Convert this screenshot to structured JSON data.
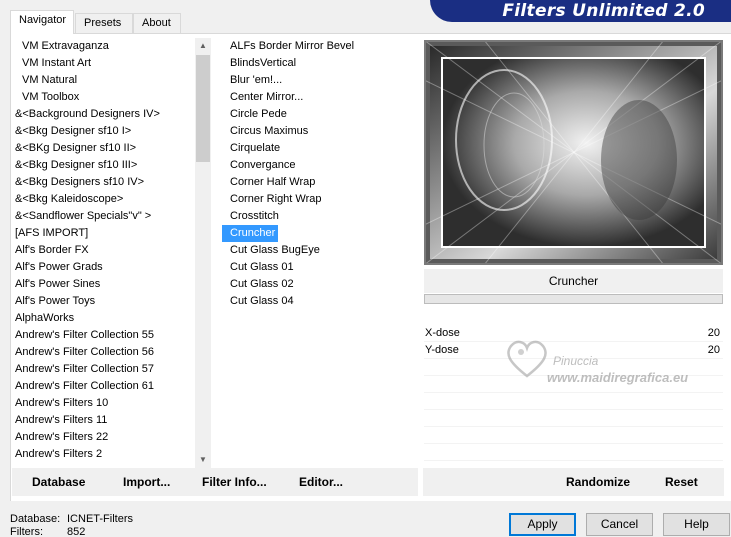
{
  "header": {
    "title": "Filters Unlimited 2.0"
  },
  "tabs": [
    {
      "label": "Navigator",
      "active": true
    },
    {
      "label": "Presets",
      "active": false
    },
    {
      "label": "About",
      "active": false
    }
  ],
  "categories": [
    "VM Extravaganza",
    "VM Instant Art",
    "VM Natural",
    "VM Toolbox",
    "&<Background Designers IV>",
    "&<Bkg Designer sf10 I>",
    "&<BKg Designer sf10 II>",
    "&<Bkg Designer sf10 III>",
    "&<Bkg Designers sf10 IV>",
    "&<Bkg Kaleidoscope>",
    "&<Sandflower Specials\"v\" >",
    "[AFS IMPORT]",
    "Alf's Border FX",
    "Alf's Power Grads",
    "Alf's Power Sines",
    "Alf's Power Toys",
    "AlphaWorks",
    "Andrew's Filter Collection 55",
    "Andrew's Filter Collection 56",
    "Andrew's Filter Collection 57",
    "Andrew's Filter Collection 61",
    "Andrew's Filters 10",
    "Andrew's Filters 11",
    "Andrew's Filters 22",
    "Andrew's Filters 2"
  ],
  "filters": [
    "ALFs Border Mirror Bevel",
    "BlindsVertical",
    "Blur 'em!...",
    "Center Mirror...",
    "Circle Pede",
    "Circus Maximus",
    "Cirquelate",
    "Convergance",
    "Corner Half Wrap",
    "Corner Right Wrap",
    "Crosstitch",
    "Cruncher",
    "Cut Glass  BugEye",
    "Cut Glass 01",
    "Cut Glass 02",
    "Cut Glass 04"
  ],
  "selected_filter": "Cruncher",
  "params": [
    {
      "label": "X-dose",
      "value": "20"
    },
    {
      "label": "Y-dose",
      "value": "20"
    }
  ],
  "watermark": {
    "name": "Pinuccia",
    "url": "www.maidiregrafica.eu"
  },
  "toolbar": {
    "database": "Database",
    "import": "Import...",
    "filter_info": "Filter Info...",
    "editor": "Editor...",
    "randomize": "Randomize",
    "reset": "Reset"
  },
  "status": {
    "database_label": "Database:",
    "database_value": "ICNET-Filters",
    "filters_label": "Filters:",
    "filters_value": "852"
  },
  "buttons": {
    "apply": "Apply",
    "cancel": "Cancel",
    "help": "Help"
  }
}
